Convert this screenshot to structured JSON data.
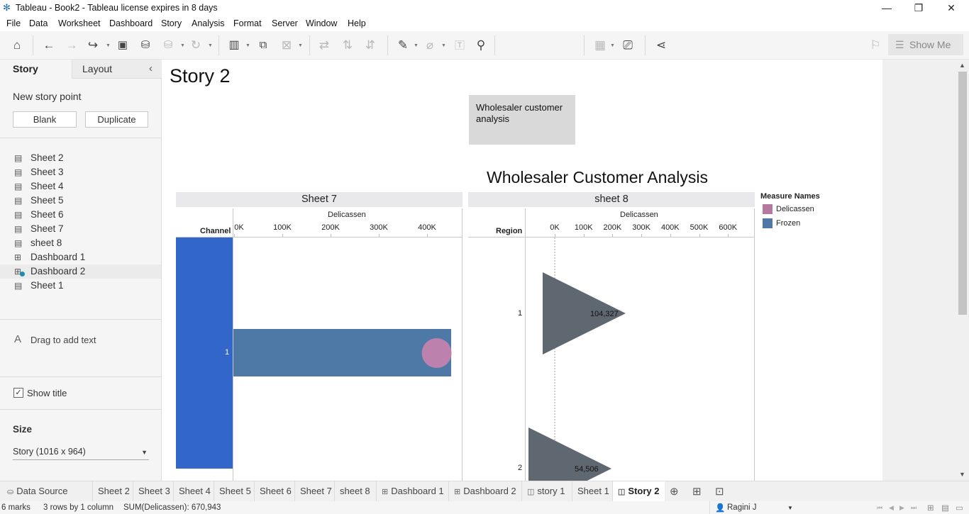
{
  "window": {
    "title": "Tableau - Book2 - Tableau license expires in 8 days",
    "controls": [
      "—",
      "❐",
      "✕"
    ]
  },
  "menu": [
    "File",
    "Data",
    "Worksheet",
    "Dashboard",
    "Story",
    "Analysis",
    "Format",
    "Server",
    "Window",
    "Help"
  ],
  "toolbar": {
    "show_me": "Show Me",
    "icons": [
      "home-icon",
      "undo-icon",
      "redo-icon",
      "replay-icon",
      "save-icon",
      "new-data-source-icon",
      "pause-updates-icon",
      "refresh-icon",
      "new-worksheet-icon",
      "duplicate-icon",
      "clear-icon",
      "swap-icon",
      "sort-asc-icon",
      "sort-desc-icon",
      "highlight-icon",
      "group-icon",
      "label-icon",
      "fix-axes-icon",
      "show-cards-icon",
      "presentation-icon",
      "share-icon",
      "paint-icon"
    ]
  },
  "left_panel": {
    "tab_story": "Story",
    "tab_layout": "Layout",
    "new_story_point": "New story point",
    "blank_button": "Blank",
    "duplicate_button": "Duplicate",
    "sheets": [
      {
        "label": "Sheet 2",
        "type": "sheet"
      },
      {
        "label": "Sheet 3",
        "type": "sheet"
      },
      {
        "label": "Sheet 4",
        "type": "sheet"
      },
      {
        "label": "Sheet 5",
        "type": "sheet"
      },
      {
        "label": "Sheet 6",
        "type": "sheet"
      },
      {
        "label": "Sheet 7",
        "type": "sheet"
      },
      {
        "label": "sheet 8",
        "type": "sheet"
      },
      {
        "label": "Dashboard 1",
        "type": "dashboard"
      },
      {
        "label": "Dashboard 2",
        "type": "dashboard",
        "selected": true
      },
      {
        "label": "Sheet 1",
        "type": "sheet"
      }
    ],
    "drag_text": "Drag to add text",
    "show_title": "Show title",
    "size_title": "Size",
    "size_value": "Story (1016 x 964)"
  },
  "story": {
    "title": "Story 2",
    "caption": "Wholesaler customer analysis",
    "dashboard_title": "Wholesaler Customer Analysis"
  },
  "sheet7": {
    "header": "Sheet 7",
    "axis_title": "Delicassen",
    "row_field": "Channel",
    "ticks": [
      "0K",
      "100K",
      "200K",
      "300K",
      "400K"
    ],
    "rows": [
      "1"
    ]
  },
  "sheet8": {
    "header": "sheet 8",
    "axis_title": "Delicassen",
    "row_field": "Region",
    "ticks": [
      "0K",
      "100K",
      "200K",
      "300K",
      "400K",
      "500K",
      "600K"
    ],
    "rows": [
      "1",
      "2"
    ],
    "labels": [
      "104,327",
      "54,506"
    ]
  },
  "legend": {
    "title": "Measure Names",
    "items": [
      {
        "label": "Delicassen",
        "color": "#b5799f"
      },
      {
        "label": "Frozen",
        "color": "#4e79a7"
      }
    ]
  },
  "colors": {
    "channel_highlight": "#3266c8",
    "frozen_bar": "#4e79a7",
    "delicassen_mark": "#c583ae",
    "triangle": "#5f6770"
  },
  "chart_data": [
    {
      "type": "bar",
      "title": "Sheet 7",
      "xlabel": "Delicassen",
      "ylabel": "Channel",
      "categories": [
        "1"
      ],
      "xlim": [
        0,
        470000
      ],
      "series": [
        {
          "name": "Frozen",
          "values": [
            450000
          ]
        },
        {
          "name": "Delicassen",
          "values": [
            420000
          ]
        }
      ]
    },
    {
      "type": "scatter",
      "title": "sheet 8",
      "xlabel": "Delicassen",
      "ylabel": "Region",
      "categories": [
        "1",
        "2"
      ],
      "xlim": [
        -80000,
        680000
      ],
      "series": [
        {
          "name": "Delicassen",
          "values": [
            104327,
            54506
          ]
        }
      ]
    }
  ],
  "bottom_tabs": [
    {
      "label": "Data Source",
      "icon": "cylinder-icon"
    },
    {
      "label": "Sheet 2"
    },
    {
      "label": "Sheet 3"
    },
    {
      "label": "Sheet 4"
    },
    {
      "label": "Sheet 5"
    },
    {
      "label": "Sheet 6"
    },
    {
      "label": "Sheet 7"
    },
    {
      "label": "sheet 8"
    },
    {
      "label": "Dashboard 1",
      "icon": "dashboard-icon"
    },
    {
      "label": "Dashboard 2",
      "icon": "dashboard-icon"
    },
    {
      "label": "story 1",
      "icon": "story-icon"
    },
    {
      "label": "Sheet 1"
    },
    {
      "label": "Story 2",
      "icon": "story-icon",
      "active": true
    }
  ],
  "status": {
    "marks": "6 marks",
    "rows": "3 rows by 1 column",
    "sum": "SUM(Delicassen): 670,943",
    "user": "Ragini J"
  }
}
